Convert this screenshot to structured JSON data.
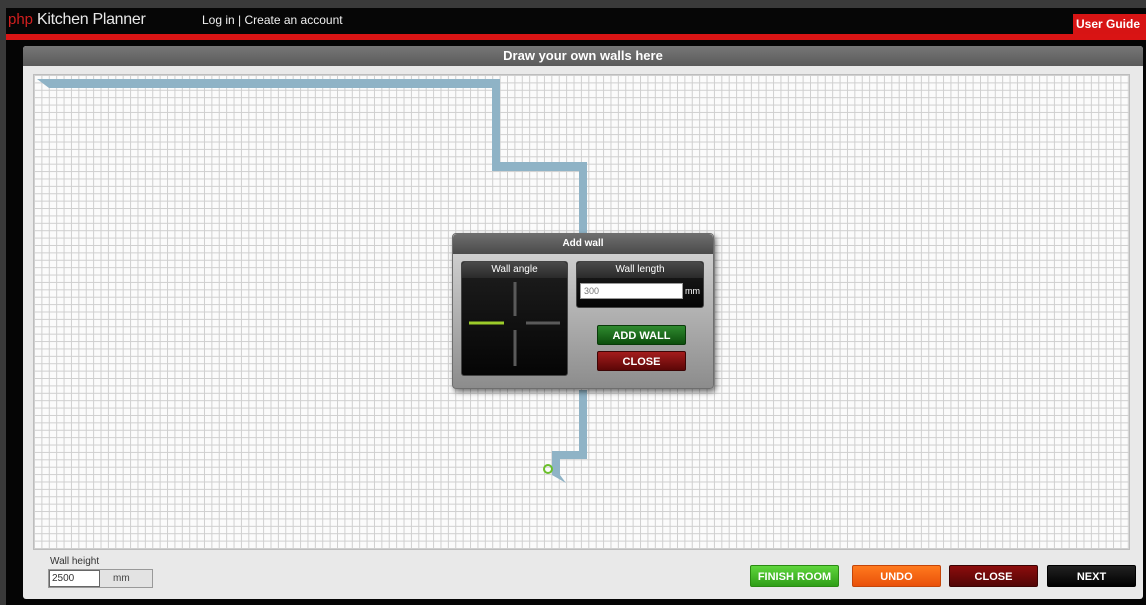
{
  "header": {
    "brand": "php",
    "app_title": "Kitchen Planner",
    "login_link": "Log in",
    "separator": "|",
    "create_account_link": "Create an account",
    "user_guide": "User Guide"
  },
  "panel": {
    "title": "Draw your own walls here"
  },
  "dialog": {
    "title": "Add wall",
    "angle_label": "Wall angle",
    "length_label": "Wall length",
    "length_placeholder": "300",
    "length_unit": "mm",
    "add_wall": "ADD WALL",
    "close": "CLOSE"
  },
  "footer": {
    "wall_height_label": "Wall height",
    "wall_height_value": "2500",
    "wall_height_unit": "mm",
    "finish_room": "FINISH ROOM",
    "undo": "UNDO",
    "close": "CLOSE",
    "next": "NEXT"
  },
  "colors": {
    "wall": "#8fb3c6",
    "brand_red": "#d21f1f",
    "angle_selected": "#9ccc2a"
  }
}
